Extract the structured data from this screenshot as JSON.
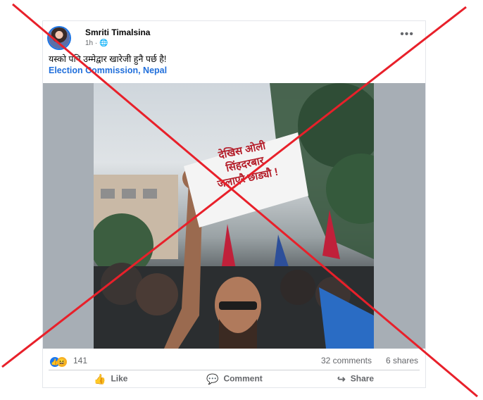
{
  "post": {
    "author": "Smriti Timalsina",
    "time": "1h",
    "audience_icon": "globe-icon",
    "more_glyph": "•••",
    "caption": "यस्को पनि उम्मेद्वार खारेजी हुनै पर्छ है!",
    "tag": "Election Commission, Nepal",
    "sign_line1": "देखिस ओली",
    "sign_line2": "सिंहदरबार",
    "sign_line3": "जलाएरै छाड्यौ !"
  },
  "stats": {
    "reactions_count": "141",
    "comments": "32 comments",
    "shares": "6 shares"
  },
  "actions": {
    "like": "Like",
    "comment": "Comment",
    "share": "Share"
  },
  "colors": {
    "cross": "#e8202a",
    "link": "#216fdb",
    "like_blue": "#1877f2"
  }
}
